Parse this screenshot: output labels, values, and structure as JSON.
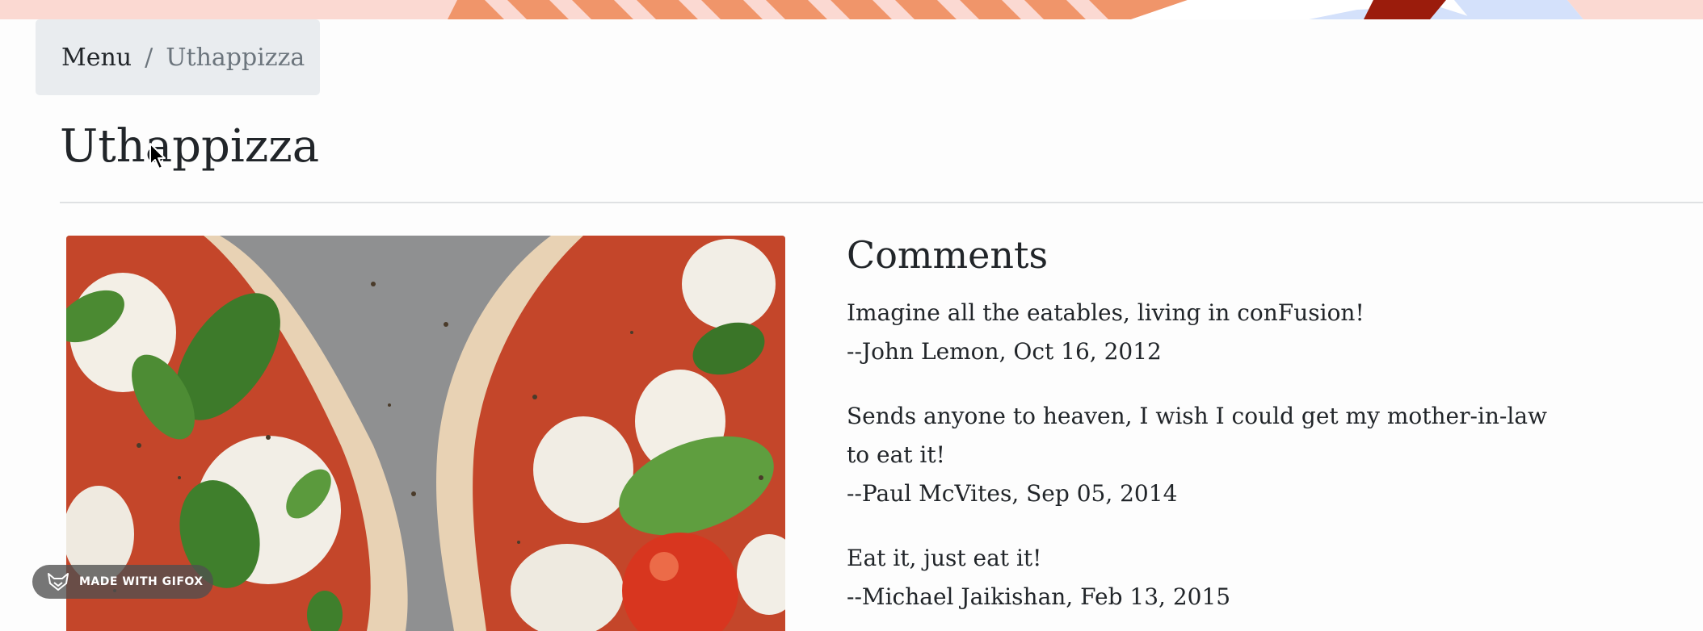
{
  "breadcrumb": {
    "link_label": "Menu",
    "separator": "/",
    "active_label": "Uthappizza"
  },
  "page": {
    "title": "Uthappizza"
  },
  "dish": {
    "image_alt": "Uthappizza"
  },
  "comments": {
    "heading": "Comments",
    "items": [
      {
        "text": "Imagine all the eatables, living in conFusion!",
        "byline": "--John Lemon, Oct 16, 2012"
      },
      {
        "text": "Sends anyone to heaven, I wish I could get my mother-in-law to eat it!",
        "byline": "--Paul McVites, Sep 05, 2014"
      },
      {
        "text": "Eat it, just eat it!",
        "byline": "--Michael Jaikishan, Feb 13, 2015"
      }
    ]
  },
  "watermark": {
    "label": "MADE WITH GIFOX"
  },
  "icons": {
    "cursor": "mouse-pointer-icon",
    "badge": "fox-logo-icon"
  },
  "colors": {
    "breadcrumb_bg": "#e9ecef",
    "muted_text": "#6c757d",
    "body_text": "#212529",
    "banner_orange": "#f0956a",
    "banner_red": "#9b1c0c",
    "banner_blue": "#d4e1fb"
  }
}
